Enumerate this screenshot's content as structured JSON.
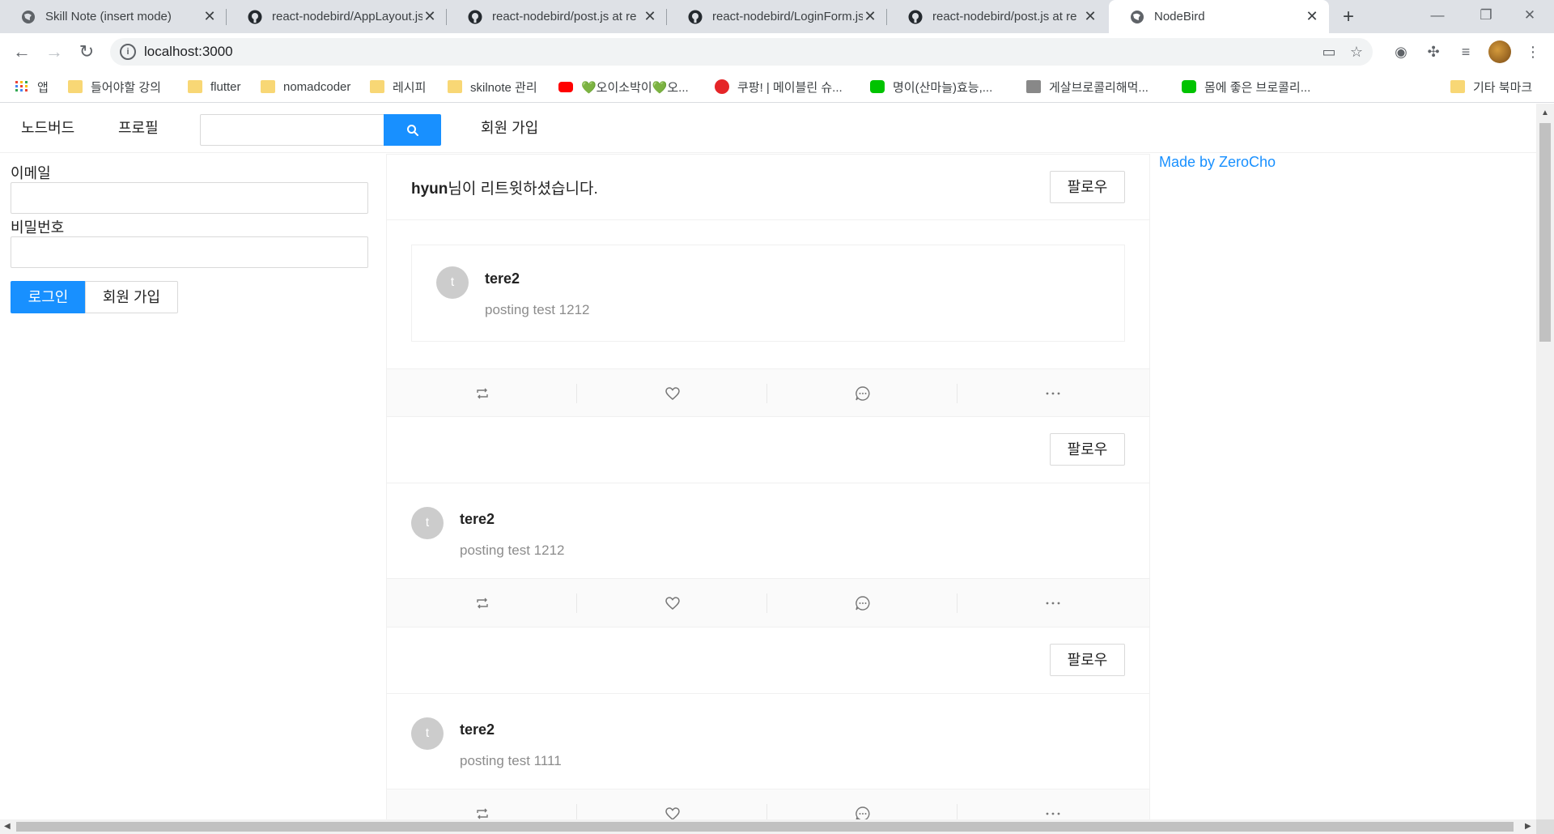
{
  "browser": {
    "tabs": [
      {
        "title": "Skill Note (insert mode)",
        "icon": "globe-icon"
      },
      {
        "title": "react-nodebird/AppLayout.js",
        "icon": "github-icon"
      },
      {
        "title": "react-nodebird/post.js at re",
        "icon": "github-icon"
      },
      {
        "title": "react-nodebird/LoginForm.js",
        "icon": "github-icon"
      },
      {
        "title": "react-nodebird/post.js at re",
        "icon": "github-icon"
      },
      {
        "title": "NodeBird",
        "icon": "globe-icon",
        "active": true
      }
    ],
    "url": "localhost:3000",
    "bookmarks": [
      {
        "label": "앱",
        "icon": "apps-grid-icon"
      },
      {
        "label": "들어야할 강의",
        "icon": "folder-icon"
      },
      {
        "label": "flutter",
        "icon": "folder-icon"
      },
      {
        "label": "nomadcoder",
        "icon": "folder-icon"
      },
      {
        "label": "레시피",
        "icon": "folder-icon"
      },
      {
        "label": "skilnote 관리",
        "icon": "folder-icon"
      },
      {
        "label": "💚오이소박이💚오...",
        "icon": "youtube-icon"
      },
      {
        "label": "쿠팡! | 메이블린 슈...",
        "icon": "coupang-icon"
      },
      {
        "label": "명이(산마늘)효능,...",
        "icon": "line-icon"
      },
      {
        "label": "게살브로콜리해먹...",
        "icon": "site-icon"
      },
      {
        "label": "몸에 좋은 브로콜리...",
        "icon": "line-icon"
      }
    ],
    "other_bookmarks": "기타 북마크"
  },
  "nav": {
    "home": "노드버드",
    "profile": "프로필",
    "search_placeholder": "",
    "signup": "회원 가입"
  },
  "login": {
    "email_label": "이메일",
    "password_label": "비밀번호",
    "login_button": "로그인",
    "signup_button": "회원 가입"
  },
  "sidebar_right": {
    "credit": "Made by ZeroCho"
  },
  "posts": [
    {
      "retweeter": "hyun",
      "retweet_suffix": "님이 리트윗하셨습니다.",
      "follow": "팔로우",
      "avatar": "t",
      "user": "tere2",
      "content": "posting test 1212"
    },
    {
      "follow": "팔로우",
      "avatar": "t",
      "user": "tere2",
      "content": "posting test 1212"
    },
    {
      "follow": "팔로우",
      "avatar": "t",
      "user": "tere2",
      "content": "posting test 1111"
    }
  ],
  "colors": {
    "primary": "#1890ff",
    "avatar_bg": "#cccccc",
    "muted_text": "#8c8c8c"
  }
}
